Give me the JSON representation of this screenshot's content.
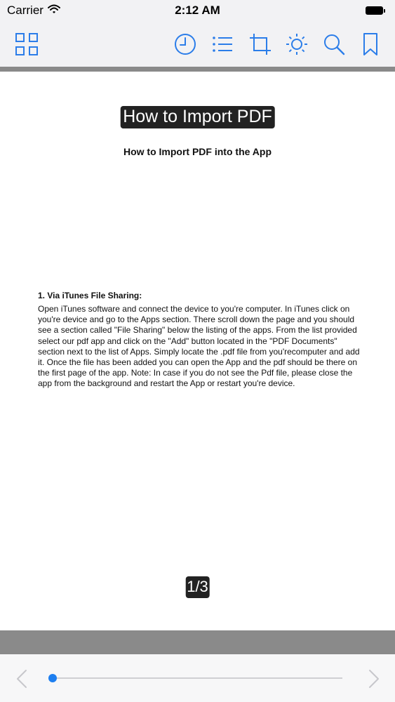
{
  "status_bar": {
    "carrier": "Carrier",
    "time": "2:12 AM",
    "wifi_icon": "wifi-icon",
    "battery_icon": "battery-icon"
  },
  "toolbar": {
    "icons": [
      "grid-icon",
      "clock-icon",
      "list-icon",
      "crop-icon",
      "brightness-icon",
      "search-icon",
      "bookmark-icon"
    ],
    "accent_color": "#2b7de9"
  },
  "document": {
    "title": "How to Import PDF",
    "heading": "How to Import PDF into the App",
    "section_heading": "1. Via iTunes File Sharing:",
    "body": "Open iTunes software and connect the device to you're computer. In iTunes click on you're device and go to the Apps section. There scroll down the page and you should see a section called \"File Sharing\" below the listing of the apps. From the list provided select our pdf app and click on the \"Add\" button located in the \"PDF Documents\" section next to the list of Apps. Simply locate the .pdf file from you'recomputer and add it. Once the file has been added you can open the App and the pdf should be there on the first page of the app. Note: In case if you do not see the Pdf file, please close the app from the background and restart the App or restart you're device."
  },
  "pagination": {
    "indicator": "1/3",
    "current_page": 1,
    "total_pages": 3
  },
  "bottom_bar": {
    "prev_icon": "chevron-left-icon",
    "next_icon": "chevron-right-icon",
    "slider_progress": 0.0,
    "slider_color": "#1e7ff0"
  }
}
